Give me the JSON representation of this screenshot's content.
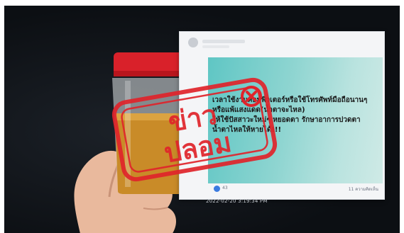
{
  "post": {
    "text": "เวลาใช้งานคอมพิวเตอร์หรือใช้โทรศัพท์มือถือนานๆ หรือแพ้แสงแดด(น้ำตาจะไหล)\nให้ใช้ปัสสาวะใหม่ๆ หยอดตา รักษาอาการปวดตา น้ำตาไหลให้หายได้!!!",
    "reaction_count": "43",
    "shares": "11 ความคิดเห็น",
    "timestamp": "2022-02-20 3:19:34 PM"
  },
  "stamp": {
    "line1": "ข่าว",
    "line2": "ปลอม",
    "color": "#e0242b"
  },
  "colors": {
    "background": "#0e1115",
    "cup_cap": "#d9212a",
    "urine": "#c98b28",
    "post_gradient_start": "#5fc6c4"
  }
}
